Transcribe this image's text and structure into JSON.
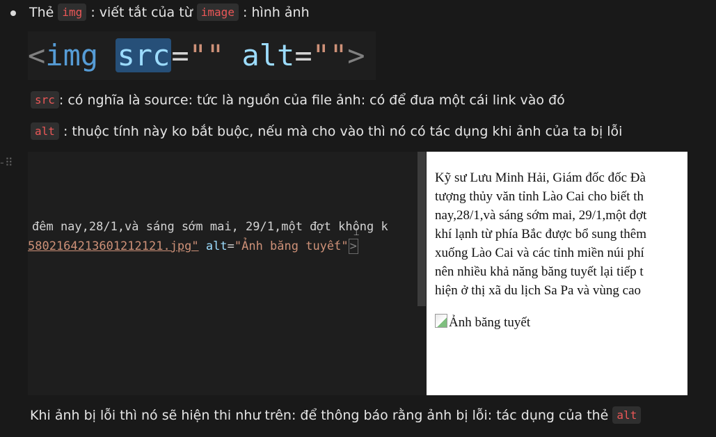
{
  "intro": {
    "prefix": "Thẻ",
    "code_img": "img",
    "middle": ": viết tắt của từ",
    "code_image": "image",
    "suffix": ": hình ảnh"
  },
  "banner": {
    "lt": "<",
    "tag": "img",
    "attr_src": "src",
    "eq1": "=",
    "val1": "\"\"",
    "attr_alt": "alt",
    "eq2": "=",
    "val2": "\"\"",
    "gt": ">"
  },
  "src_line": {
    "code": "src",
    "text": ": có nghĩa là source: tức là nguồn của file ảnh: có để đưa một cái link vào đó"
  },
  "alt_line": {
    "code": "alt",
    "text": ": thuộc tính này ko bắt buộc, nếu mà cho vào thì nó có tác dụng khi ảnh của ta bị lỗi"
  },
  "editor": {
    "line1": "đêm nay,28/1,và sáng sớm mai, 29/1,một đợt không k",
    "line2_src": "5802164213601212121.jpg\"",
    "line2_attr": "alt",
    "line2_eq": "=",
    "line2_val": "\"Ảnh băng tuyết\"",
    "line2_end": ">"
  },
  "preview": {
    "lines": [
      "Kỹ sư Lưu Minh Hải, Giám đốc đốc Đà",
      "tượng thủy văn tỉnh Lào Cai cho biết th",
      "nay,28/1,và sáng sớm mai, 29/1,một đợt",
      "khí lạnh từ phía Bắc được bổ sung thêm",
      "xuống Lào Cai và các tỉnh miền núi phí",
      "nên nhiều khả năng băng tuyết lại tiếp t",
      "hiện ở thị xã du lịch Sa Pa và vùng cao"
    ],
    "alt_text": "Ảnh băng tuyết"
  },
  "conclusion": {
    "text": "Khi ảnh bị lỗi thì nó sẽ hiện thi như trên: để thông báo rằng ảnh bị lỗi: tác dụng của thẻ",
    "code": "alt"
  }
}
